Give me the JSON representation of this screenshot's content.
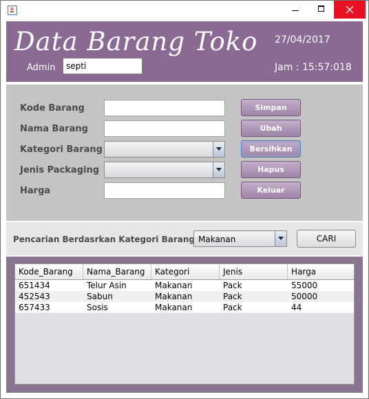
{
  "window": {
    "icon": "java-coffee-icon",
    "controls": {
      "minimize": "minimize-icon",
      "maximize": "maximize-icon",
      "close": "close-icon"
    }
  },
  "header": {
    "title": "Data Barang Toko",
    "admin_label": "Admin",
    "admin_value": "septi",
    "date": "27/04/2017",
    "clock": "Jam : 15:57:018",
    "background": "#8a6a93"
  },
  "form": {
    "kode_label": "Kode Barang",
    "nama_label": "Nama Barang",
    "kategori_label": "Kategori Barang",
    "jenis_label": "Jenis Packaging",
    "harga_label": "Harga",
    "kode_value": "",
    "nama_value": "",
    "kategori_value": "",
    "jenis_value": "",
    "harga_value": ""
  },
  "actions": {
    "simpan": "Simpan",
    "ubah": "Ubah",
    "bersihkan": "Bersihkan",
    "hapus": "Hapus",
    "keluar": "Keluar",
    "color": "#a68db0"
  },
  "search": {
    "label": "Pencarian Berdasrkan Kategori Barang",
    "selected": "Makanan",
    "button": "CARI"
  },
  "table": {
    "columns": [
      "Kode_Barang",
      "Nama_Barang",
      "Kategori",
      "Jenis",
      "Harga"
    ],
    "rows": [
      [
        "651434",
        "Telur Asin",
        "Makanan",
        "Pack",
        "55000"
      ],
      [
        "452543",
        "Sabun",
        "Makanan",
        "Pack",
        "50000"
      ],
      [
        "657433",
        "Sosis",
        "Makanan",
        "Pack",
        "44"
      ]
    ]
  }
}
